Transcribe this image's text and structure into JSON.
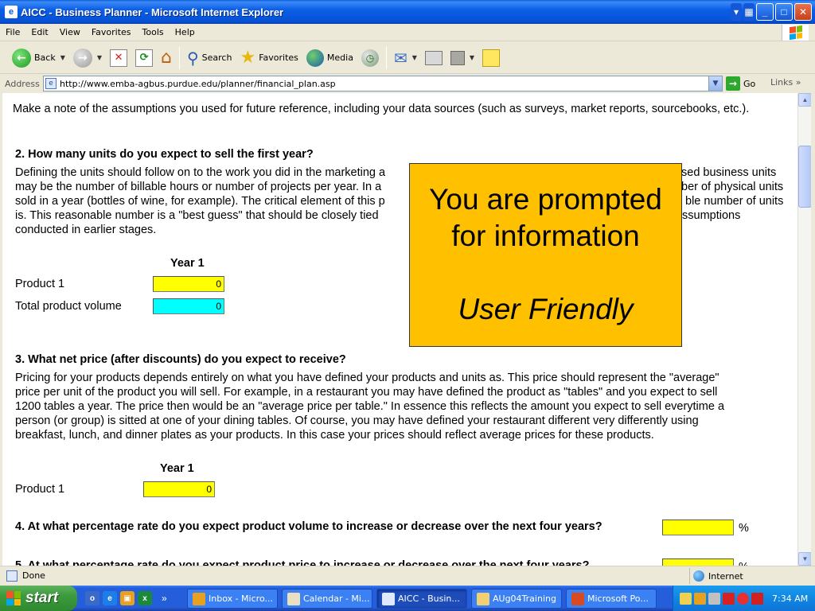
{
  "window": {
    "title": "AICC - Business Planner - Microsoft Internet Explorer"
  },
  "menu": {
    "items": [
      "File",
      "Edit",
      "View",
      "Favorites",
      "Tools",
      "Help"
    ]
  },
  "toolbar": {
    "back_label": "Back",
    "search_label": "Search",
    "favorites_label": "Favorites",
    "media_label": "Media"
  },
  "address": {
    "label": "Address",
    "url": "http://www.emba-agbus.purdue.edu/planner/financial_plan.asp",
    "go_label": "Go",
    "links_label": "Links"
  },
  "page": {
    "intro": "Make a note of the assumptions you used for future reference, including your data sources (such as surveys, market reports, sourcebooks, etc.).",
    "q2_heading": "2. How many units do you expect to sell the first year?",
    "q2_line1": "Defining the units should follow on to the work you did in the marketing a",
    "q2_line1_tail": "sed business units",
    "q2_line2": "may be the number of billable hours or number of projects per year. In a",
    "q2_line2_tail": "ber of physical units",
    "q2_line3": "sold in a year (bottles of wine, for example). The critical element of this p",
    "q2_line3_tail": "ble number of units",
    "q2_line4": "is. This reasonable number is a \"best guess\" that should be closely tied",
    "q2_line4_tail": "ssumptions",
    "q2_line5": "conducted in earlier stages.",
    "q2_year_header": "Year 1",
    "q2_product_label": "Product 1",
    "q2_product_value": "0",
    "q2_total_label": "Total product volume",
    "q2_total_value": "0",
    "q3_heading": "3. What net price (after discounts) do you expect to receive?",
    "q3_line1": "Pricing for your products depends entirely on what you have defined your products and units as. This price should represent the \"average\"",
    "q3_line2": "price per unit of the product you will sell. For example, in a restaurant you may have defined the product as \"tables\" and you expect to sell",
    "q3_line3": "1200 tables a year. The price then would be an \"average price per table.\" In essence this reflects the amount you expect to sell everytime a",
    "q3_line4": "person (or group) is sitted at one of your dining tables. Of course, you may have defined your restaurant different very differently using",
    "q3_line5": "breakfast, lunch, and dinner plates as your products. In this case your prices should reflect average prices for these products.",
    "q3_year_header": "Year 1",
    "q3_product_label": "Product 1",
    "q3_product_value": "0",
    "q4_heading": "4. At what percentage rate do you expect product volume to increase or decrease over the next four years?",
    "q4_unit": "%",
    "q5_heading_partial": "5. At what percentage rate do you expect product price to increase or decrease over the next four years?",
    "q5_unit": "%"
  },
  "overlay": {
    "line1": "You are prompted",
    "line2": "for information",
    "line3": "User Friendly"
  },
  "status": {
    "text": "Done",
    "zone": "Internet"
  },
  "taskbar": {
    "start_label": "start",
    "tasks": [
      "Inbox - Micro...",
      "Calendar - Mi...",
      "AICC - Busin...",
      "AUg04Training",
      "Microsoft Po..."
    ],
    "clock": "7:34 AM"
  },
  "colors": {
    "overlay_bg": "#ffc000",
    "input_yellow": "#ffff00",
    "input_cyan": "#00ffff",
    "titlebar_blue": "#0553d6"
  }
}
